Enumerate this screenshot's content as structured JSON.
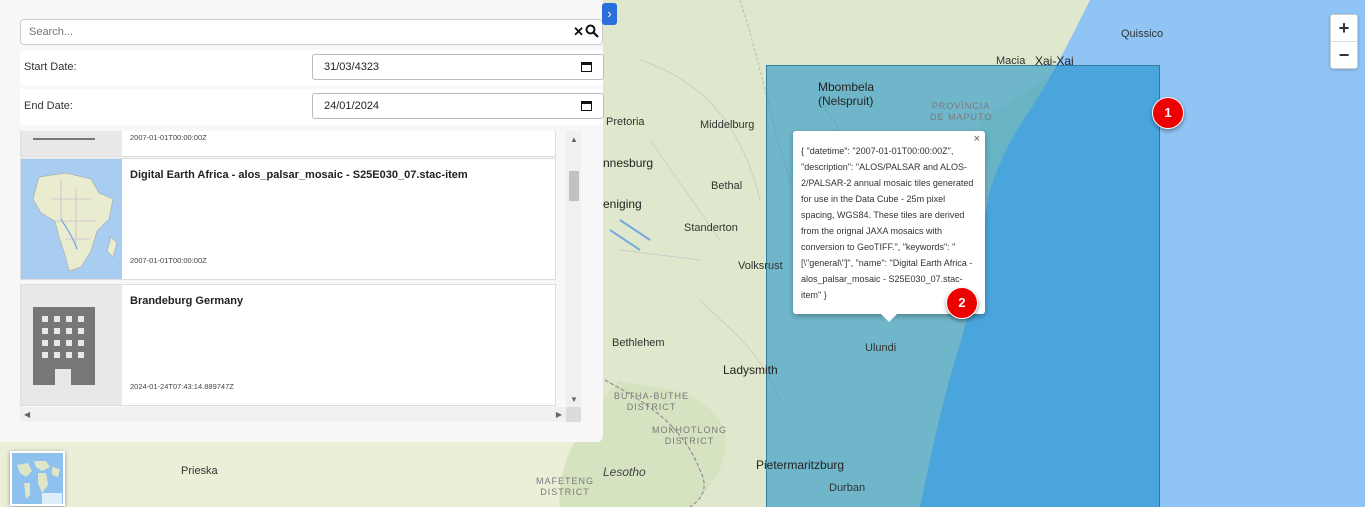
{
  "search": {
    "placeholder": "Search...",
    "clear_icon": "close-icon",
    "search_icon": "magnifier-icon"
  },
  "filters": {
    "start_label": "Start Date:",
    "start_value": "31/03/4323",
    "end_label": "End Date:",
    "end_value": "24/01/2024"
  },
  "results": [
    {
      "title": "",
      "date": "2007-01-01T00:00:00Z"
    },
    {
      "title": "Digital Earth Africa - alos_palsar_mosaic - S25E030_07.stac-item",
      "date": "2007-01-01T00:00:00Z"
    },
    {
      "title": "Brandeburg Germany",
      "date": "2024-01-24T07:43:14.889747Z"
    }
  ],
  "popup": {
    "close": "×",
    "text": "{ \"datetime\": \"2007-01-01T00:00:00Z\", \"description\": \"ALOS/PALSAR and ALOS-2/PALSAR-2 annual mosaic tiles generated for use in the Data Cube - 25m pixel spacing, WGS84. These tiles are derived from the orignal JAXA mosaics with conversion to GeoTIFF.\", \"keywords\": \"[\\\"general\\\"]\", \"name\": \"Digital Earth Africa - alos_palsar_mosaic - S25E030_07.stac-item\" }"
  },
  "zoom": {
    "in": "+",
    "out": "−"
  },
  "badges": [
    "1",
    "2"
  ],
  "map_labels": {
    "pretoria": "Pretoria",
    "middelburg": "Middelburg",
    "mbombela": "Mbombela",
    "nelspruit": "(Nelspruit)",
    "maputo_prov_1": "PROVÍNCIA",
    "maputo_prov_2": "DE MAPUTO",
    "macia": "Macia",
    "xai_xai": "Xai-Xai",
    "quissico": "Quissico",
    "johannesburg": "nnesburg",
    "bethal": "Bethal",
    "eniging": "eniging",
    "standerton": "Standerton",
    "volksrust": "Volksrust",
    "bethlehem": "Bethlehem",
    "ladysmith": "Ladysmith",
    "ulundi": "Ulundi",
    "butha_1": "BUTHA-BUTHE",
    "butha_2": "DISTRICT",
    "mokhotlong_1": "MOKHOTLONG",
    "mokhotlong_2": "DISTRICT",
    "lesotho": "Lesotho",
    "mafeteng_1": "MAFETENG",
    "mafeteng_2": "DISTRICT",
    "priska": "Prieska",
    "pietermaritzburg": "Pietermaritzburg",
    "durban": "Durban"
  },
  "colors": {
    "overlay": "#2a8fc4",
    "ocean": "#8fc4f5",
    "land": "#e8ecd3",
    "badge": "#e00000",
    "toggle": "#2a6fdb"
  }
}
